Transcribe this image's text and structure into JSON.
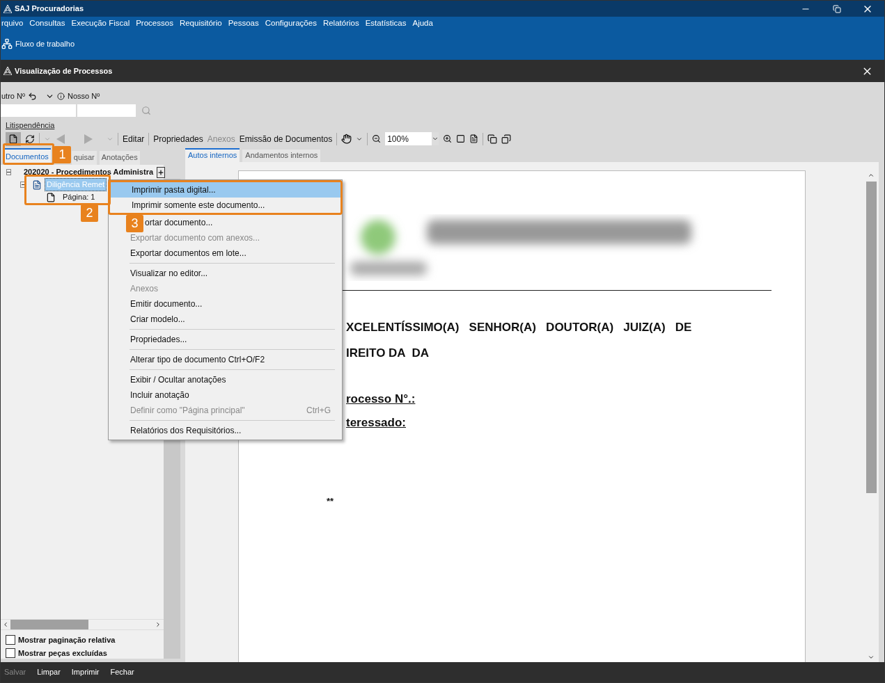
{
  "app_window": {
    "title": "SAJ Procuradorias"
  },
  "menu_bar": [
    "rquivo",
    "Consultas",
    "Execução Fiscal",
    "Processos",
    "Requisitório",
    "Pessoas",
    "Configurações",
    "Relatórios",
    "Estatísticas",
    "Ajuda"
  ],
  "shortcut_bar": {
    "label": "Fluxo de trabalho"
  },
  "inner_window": {
    "title": "Visualização de Processos"
  },
  "search": {
    "label_1": "utro Nº",
    "label_2": "Nosso Nº",
    "link": "Litispendência"
  },
  "toolbar": [
    {
      "label": "Editar",
      "disabled": false
    },
    {
      "label": "Propriedades",
      "disabled": false
    },
    {
      "label": "Anexos",
      "disabled": true
    },
    {
      "label": "Emissão de Documentos",
      "disabled": false
    }
  ],
  "zoom": {
    "value": "100%"
  },
  "left_tabs": [
    {
      "label": "Documentos",
      "selected": true
    },
    {
      "label": "quisar",
      "selected": false
    },
    {
      "label": "Anotações",
      "selected": false
    }
  ],
  "tree": [
    {
      "label": "202020 - Procedimentos Administra",
      "expanded": true,
      "selected": false,
      "children": [
        {
          "label": "Diligência Remet",
          "expanded": true,
          "selected": true,
          "children": [
            {
              "label": "Página: 1",
              "selected": false
            }
          ]
        }
      ]
    }
  ],
  "options": [
    {
      "label": "Mostrar paginação relativa",
      "checked": false
    },
    {
      "label": "Mostrar peças excluídas",
      "checked": false
    }
  ],
  "right_tabs": [
    {
      "label": "Autos internos",
      "selected": true
    },
    {
      "label": "Andamentos internos",
      "selected": false
    }
  ],
  "document": {
    "lines": [
      {
        "text": "XCELENTÍSSIMO(A)   SENHOR(A)   DOUTOR(A)   JUIZ(A)   DE",
        "underline": false
      },
      {
        "text": "IREITO DA  DA",
        "underline": false
      },
      {
        "text": "rocesso N°.:",
        "underline": true
      },
      {
        "text": "teressado:",
        "underline": true
      }
    ],
    "footnote": "**"
  },
  "context_menu": [
    {
      "label": "Imprimir pasta digital...",
      "disabled": false,
      "selected": true,
      "separator_before": false
    },
    {
      "label": "Imprimir somente este documento...",
      "disabled": false,
      "selected": false,
      "separator_before": false
    },
    {
      "label": "ortar documento...",
      "disabled": false,
      "selected": false,
      "separator_before": false
    },
    {
      "label": "Exportar documento com anexos...",
      "disabled": true,
      "selected": false,
      "separator_before": false
    },
    {
      "label": "Exportar documentos em lote...",
      "disabled": false,
      "selected": false,
      "separator_before": false
    },
    {
      "label": "Visualizar no editor...",
      "disabled": false,
      "selected": false,
      "separator_before": true
    },
    {
      "label": "Anexos",
      "disabled": true,
      "selected": false,
      "separator_before": false
    },
    {
      "label": "Emitir documento...",
      "disabled": false,
      "selected": false,
      "separator_before": false
    },
    {
      "label": "Criar modelo...",
      "disabled": false,
      "selected": false,
      "separator_before": false
    },
    {
      "label": "Propriedades...",
      "disabled": false,
      "selected": false,
      "separator_before": true
    },
    {
      "label": "Alterar tipo de documento Ctrl+O/F2",
      "disabled": false,
      "selected": false,
      "separator_before": true
    },
    {
      "label": "Exibir / Ocultar anotações",
      "disabled": false,
      "selected": false,
      "separator_before": true
    },
    {
      "label": "Incluir anotação",
      "disabled": false,
      "selected": false,
      "separator_before": false
    },
    {
      "label": "Definir como \"Página principal\"",
      "shortcut": "Ctrl+G",
      "disabled": true,
      "selected": false,
      "separator_before": false
    },
    {
      "label": "Relatórios dos Requisitórios...",
      "disabled": false,
      "selected": false,
      "separator_before": true
    }
  ],
  "callouts": [
    "1",
    "2",
    "3"
  ],
  "bottom_bar": [
    {
      "label": "Salvar",
      "disabled": true
    },
    {
      "label": "Limpar",
      "disabled": false
    },
    {
      "label": "Imprimir",
      "disabled": false
    },
    {
      "label": "Fechar",
      "disabled": false
    }
  ]
}
